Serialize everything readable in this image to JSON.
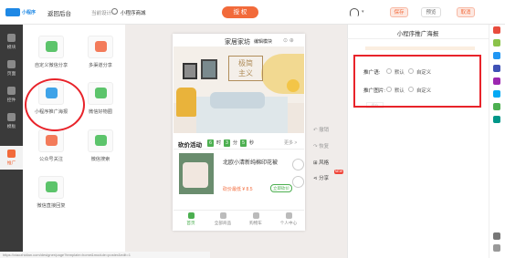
{
  "topbar": {
    "logo_text": "小程序",
    "back_label": "返回后台",
    "current_design_label": "当前设计:",
    "current_design_value": "小程序商城",
    "publish_label": "授 权",
    "save_label": "保存",
    "preview_label": "预览",
    "cancel_label": "取消"
  },
  "leftnav": {
    "items": [
      {
        "label": "模块",
        "active": false
      },
      {
        "label": "页面",
        "active": false
      },
      {
        "label": "控件",
        "active": false
      },
      {
        "label": "模板",
        "active": false
      },
      {
        "label": "推广",
        "active": true
      }
    ]
  },
  "modules": {
    "items": [
      {
        "label": "自定义微信分享",
        "color": "#5cc46b"
      },
      {
        "label": "多渠道分享",
        "color": "#f37b5a"
      },
      {
        "label": "小程序推广海报",
        "color": "#3ea3e8"
      },
      {
        "label": "微信好物圈",
        "color": "#5cc46b"
      },
      {
        "label": "公众号关注",
        "color": "#f37b5a"
      },
      {
        "label": "微信搜索",
        "color": "#5cc46b"
      },
      {
        "label": "微信直接回复",
        "color": "#5cc46b"
      }
    ]
  },
  "phone": {
    "title": "家居家坊",
    "subtitle": "编辑模块",
    "banner_text_line1": "极简",
    "banner_text_line2": "主义",
    "deal_title": "砍价活动",
    "countdown": [
      "6",
      "时",
      "3",
      "分",
      "5",
      "秒"
    ],
    "more": "更多 >",
    "product_title": "北欧小清新纯棉印花被",
    "product_price": "砍价最低 ¥ 8.5",
    "buy_label": "立即砍价",
    "tabs": [
      {
        "label": "首页",
        "active": true
      },
      {
        "label": "全部商品",
        "active": false
      },
      {
        "label": "购物车",
        "active": false
      },
      {
        "label": "个人中心",
        "active": false
      }
    ]
  },
  "side_tools": {
    "undo": "撤销",
    "redo": "恢复",
    "style": "风格",
    "share": "分享",
    "new_badge": "NEW"
  },
  "props": {
    "title": "小程序推广海报",
    "entry_label": "推广语:",
    "entry_options": [
      "默认",
      "自定义"
    ],
    "image_label": "推广图片:",
    "image_options": [
      "默认",
      "自定义"
    ],
    "faint_button": "保存"
  },
  "statusbar": {
    "text": "https://xiaozhidian.com/designer/page?template=home&module=poster&edit=1"
  },
  "colors": {
    "accent": "#f26a3a",
    "green": "#4caf50",
    "highlight": "#e8232a"
  }
}
